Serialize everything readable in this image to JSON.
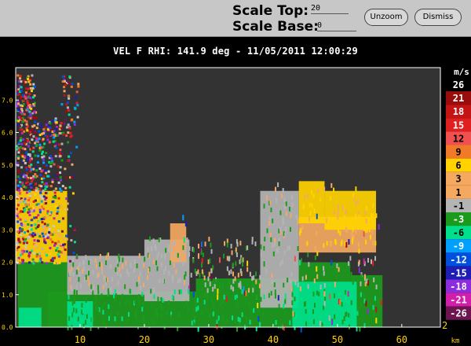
{
  "toolbar": {
    "scale_top_label": "Scale Top:",
    "scale_top_value": "20",
    "scale_base_label": "Scale Base:",
    "scale_base_value": "0",
    "unzoom_label": "Unzoom",
    "dismiss_label": "Dismiss"
  },
  "plot": {
    "title": "VEL F  RHI: 141.9 deg  -  11/05/2011 12:00:29",
    "corner_label": "2",
    "background": "#333333",
    "frame_color": "#ffffff"
  },
  "chart_data": {
    "type": "heatmap",
    "title": "VEL F  RHI: 141.9 deg  -  11/05/2011 12:00:29",
    "xlabel": "km",
    "ylabel": "",
    "xlim": [
      0,
      66
    ],
    "ylim": [
      0,
      8
    ],
    "x_ticks": [
      10,
      20,
      30,
      40,
      50,
      60
    ],
    "x_tick_labels": [
      "10",
      "20",
      "30",
      "40",
      "50",
      "60"
    ],
    "y_ticks": [
      0,
      1,
      2,
      3,
      4,
      5,
      6,
      7
    ],
    "y_tick_labels": [
      "0.0",
      "1.0",
      "2.0",
      "3.0",
      "4.0",
      "5.0",
      "6.0",
      "7.0"
    ],
    "colorbar": {
      "unit": "m/s",
      "entries": [
        {
          "label": "26",
          "color": "#c8c8c8"
        },
        {
          "label": "21",
          "color": "#9b0c0c"
        },
        {
          "label": "18",
          "color": "#c41414"
        },
        {
          "label": "15",
          "color": "#e02020"
        },
        {
          "label": "12",
          "color": "#f05050"
        },
        {
          "label": "9",
          "color": "#f07a28"
        },
        {
          "label": "6",
          "color": "#ffd200"
        },
        {
          "label": "3",
          "color": "#f4a860"
        },
        {
          "label": "1",
          "color": "#f4a860"
        },
        {
          "label": "-1",
          "color": "#b4b4b4"
        },
        {
          "label": "-3",
          "color": "#1c9a1c"
        },
        {
          "label": "-6",
          "color": "#00e08c"
        },
        {
          "label": "-9",
          "color": "#00a0ff"
        },
        {
          "label": "-12",
          "color": "#0050e0"
        },
        {
          "label": "-15",
          "color": "#1e1eb4"
        },
        {
          "label": "-18",
          "color": "#8c2cdc"
        },
        {
          "label": "-21",
          "color": "#d21eaa"
        },
        {
          "label": "-26",
          "color": "#6e1450"
        }
      ]
    },
    "echo_regions": [
      {
        "x0": 0.3,
        "x1": 8.0,
        "y0": 0.0,
        "y1": 2.0,
        "color": "#1c9a1c"
      },
      {
        "x0": 5.0,
        "x1": 28.0,
        "y0": 0.0,
        "y1": 1.1,
        "color": "#1c9a1c"
      },
      {
        "x0": 28.0,
        "x1": 44.0,
        "y0": 0.0,
        "y1": 1.5,
        "color": "#1c9a1c"
      },
      {
        "x0": 44.0,
        "x1": 52.0,
        "y0": 0.0,
        "y1": 2.0,
        "color": "#1c9a1c"
      },
      {
        "x0": 52.0,
        "x1": 57.0,
        "y0": 0.0,
        "y1": 1.6,
        "color": "#1c9a1c"
      },
      {
        "x0": 8.0,
        "x1": 20.0,
        "y0": 1.0,
        "y1": 2.2,
        "color": "#b4b4b4"
      },
      {
        "x0": 20.0,
        "x1": 27.0,
        "y0": 0.8,
        "y1": 2.7,
        "color": "#b4b4b4"
      },
      {
        "x0": 38.0,
        "x1": 44.0,
        "y0": 0.6,
        "y1": 4.2,
        "color": "#b4b4b4"
      },
      {
        "x0": 0.0,
        "x1": 8.0,
        "y0": 2.0,
        "y1": 4.2,
        "color": "#ffd200"
      },
      {
        "x0": 24.0,
        "x1": 26.5,
        "y0": 2.0,
        "y1": 3.2,
        "color": "#f4a860"
      },
      {
        "x0": 44.0,
        "x1": 56.0,
        "y0": 2.3,
        "y1": 3.4,
        "color": "#f4a860"
      },
      {
        "x0": 44.0,
        "x1": 48.0,
        "y0": 3.2,
        "y1": 4.5,
        "color": "#ffd200"
      },
      {
        "x0": 48.0,
        "x1": 56.0,
        "y0": 3.0,
        "y1": 4.2,
        "color": "#ffd200"
      },
      {
        "x0": 43.0,
        "x1": 53.0,
        "y0": 0.0,
        "y1": 1.4,
        "color": "#00e08c"
      },
      {
        "x0": 0.5,
        "x1": 4.0,
        "y0": 0.0,
        "y1": 0.6,
        "color": "#00e08c"
      },
      {
        "x0": 8.0,
        "x1": 12.0,
        "y0": 0.0,
        "y1": 0.8,
        "color": "#00e08c"
      },
      {
        "x0": 0.0,
        "x1": 10.0,
        "y0": 2.0,
        "y1": 7.8,
        "color": "#d21eaa"
      }
    ]
  }
}
